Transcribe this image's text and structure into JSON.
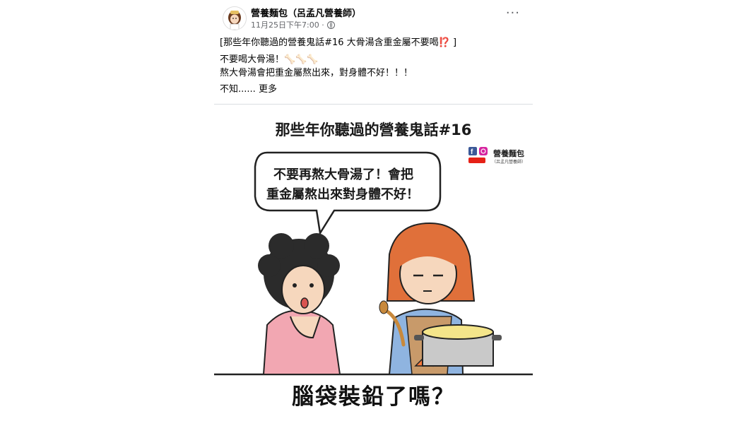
{
  "post": {
    "page_name": "營養麵包（呂孟凡營養師）",
    "timestamp": "11月25日下午7:00 ·",
    "more_menu": "···",
    "lines": [
      "[那些年你聽過的營養鬼話#16 大骨湯含重金屬不要喝⁉️ ]",
      "不要喝大骨湯！🦴🦴🦴",
      "熬大骨湯會把重金屬熬出來，對身體不好！！！",
      "不知......"
    ],
    "see_more": "更多"
  },
  "comic": {
    "title": "那些年你聽過的營養鬼話#16",
    "bubble_line1": "不要再熬大骨湯了！會把",
    "bubble_line2": "重金屬熬出來對身體不好！",
    "brand_name": "營養麵包",
    "brand_sub": "（呂孟凡營養師）",
    "caption": "腦袋裝鉛了嗎？",
    "colors": {
      "pink_shirt": "#f2a7b2",
      "red_hair": "#e0703a",
      "blue_shirt": "#8fb4e0",
      "apron": "#c89a6a",
      "soup": "#f4e58a",
      "pot": "#c9c9c9",
      "flame": "#ff7a3a"
    }
  }
}
